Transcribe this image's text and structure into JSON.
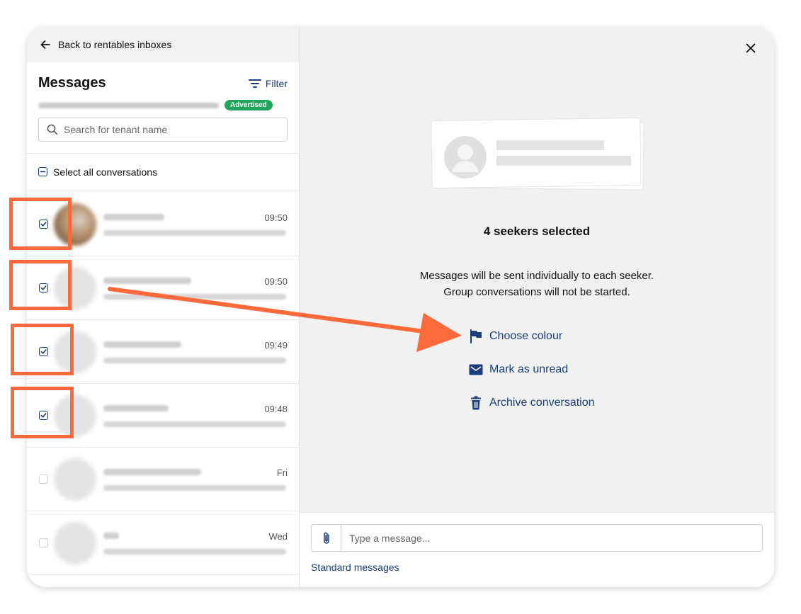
{
  "nav": {
    "back_label": "Back to rentables inboxes"
  },
  "sidebar": {
    "title": "Messages",
    "filter_label": "Filter",
    "listing_badge": "Advertised",
    "search_placeholder": "Search for tenant name",
    "select_all_label": "Select all conversations",
    "conversations": [
      {
        "time": "09:50",
        "selected": true
      },
      {
        "time": "09:50",
        "selected": true
      },
      {
        "time": "09:49",
        "selected": true
      },
      {
        "time": "09:48",
        "selected": true
      },
      {
        "time": "Fri",
        "selected": false
      },
      {
        "time": "Wed",
        "selected": false
      }
    ]
  },
  "main": {
    "selected_title": "4 seekers selected",
    "info_line1": "Messages will be sent individually to each seeker.",
    "info_line2": "Group conversations will not be started.",
    "actions": [
      {
        "label": "Choose colour",
        "icon": "flag-icon"
      },
      {
        "label": "Mark as unread",
        "icon": "envelope-icon"
      },
      {
        "label": "Archive conversation",
        "icon": "trash-icon"
      }
    ]
  },
  "composer": {
    "placeholder": "Type a message...",
    "standard_messages_label": "Standard messages"
  },
  "colors": {
    "accent": "#1c3d7a",
    "badge": "#22a45a",
    "annotation": "#fb6a3b"
  }
}
